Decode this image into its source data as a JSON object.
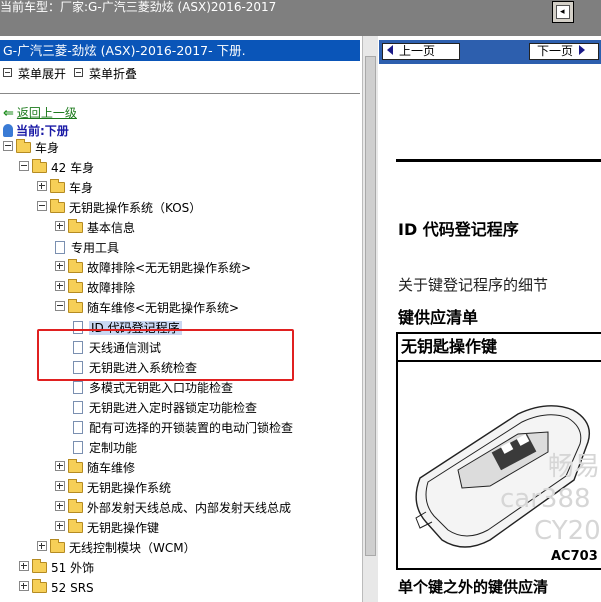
{
  "top": {
    "vehicle_label": "当前车型：",
    "vehicle_value": "厂家:G-广汽三菱劲炫 (ASX)2016-2017",
    "toggle_glyph": "◂"
  },
  "left": {
    "title": "G-广汽三菱-劲炫 (ASX)-2016-2017- 下册.",
    "expand_label": "菜单展开",
    "collapse_label": "菜单折叠",
    "back_label": "返回上一级",
    "current_label": "当前:下册",
    "tree": [
      {
        "label": "车身",
        "type": "folder",
        "toggle": "minus"
      },
      {
        "label": "42 车身",
        "type": "folder",
        "toggle": "minus"
      },
      {
        "label": "车身",
        "type": "folder",
        "toggle": "plus"
      },
      {
        "label": "无钥匙操作系统（KOS）",
        "type": "folder",
        "toggle": "minus"
      },
      {
        "label": "基本信息",
        "type": "folder",
        "toggle": "plus"
      },
      {
        "label": "专用工具",
        "type": "doc"
      },
      {
        "label": "故障排除<无无钥匙操作系统>",
        "type": "folder",
        "toggle": "plus"
      },
      {
        "label": "故障排除",
        "type": "folder",
        "toggle": "plus"
      },
      {
        "label": "随车维修<无钥匙操作系统>",
        "type": "folder",
        "toggle": "minus"
      },
      {
        "label": "ID 代码登记程序",
        "type": "doc",
        "selected": true
      },
      {
        "label": "天线通信测试",
        "type": "doc"
      },
      {
        "label": "无钥匙进入系统检查",
        "type": "doc"
      },
      {
        "label": "多模式无钥匙入口功能检查",
        "type": "doc"
      },
      {
        "label": "无钥匙进入定时器锁定功能检查",
        "type": "doc"
      },
      {
        "label": "配有可选择的开锁装置的电动门锁检查",
        "type": "doc"
      },
      {
        "label": "定制功能",
        "type": "doc"
      },
      {
        "label": "随车维修",
        "type": "folder",
        "toggle": "plus"
      },
      {
        "label": "无钥匙操作系统",
        "type": "folder",
        "toggle": "plus"
      },
      {
        "label": "外部发射天线总成、内部发射天线总成",
        "type": "folder",
        "toggle": "plus"
      },
      {
        "label": "无钥匙操作键",
        "type": "folder",
        "toggle": "plus"
      },
      {
        "label": "无线控制模块（WCM）",
        "type": "folder",
        "toggle": "plus"
      },
      {
        "label": "51 外饰",
        "type": "folder",
        "toggle": "plus"
      },
      {
        "label": "52 SRS",
        "type": "folder",
        "toggle": "plus"
      }
    ]
  },
  "right": {
    "prev_label": "上一页",
    "next_label": "下一页",
    "doc_title": "ID  代码登记程序",
    "intro_text": "关于键登记程序的细节",
    "section_title": "键供应清单",
    "box_header": "无钥匙操作键",
    "figure_label": "AC703",
    "watermark_1": "畅易",
    "watermark_2": "car388",
    "watermark_3": "CY20",
    "bottom_text": "单个键之外的键供应清"
  },
  "colors": {
    "topbar": "#7f7f7f",
    "title_bar": "#0a55b8",
    "nav_bar": "#2d5fae",
    "highlight_box": "#e02020",
    "back_link": "#1c7a1c",
    "current_label": "#1a1aa6"
  }
}
